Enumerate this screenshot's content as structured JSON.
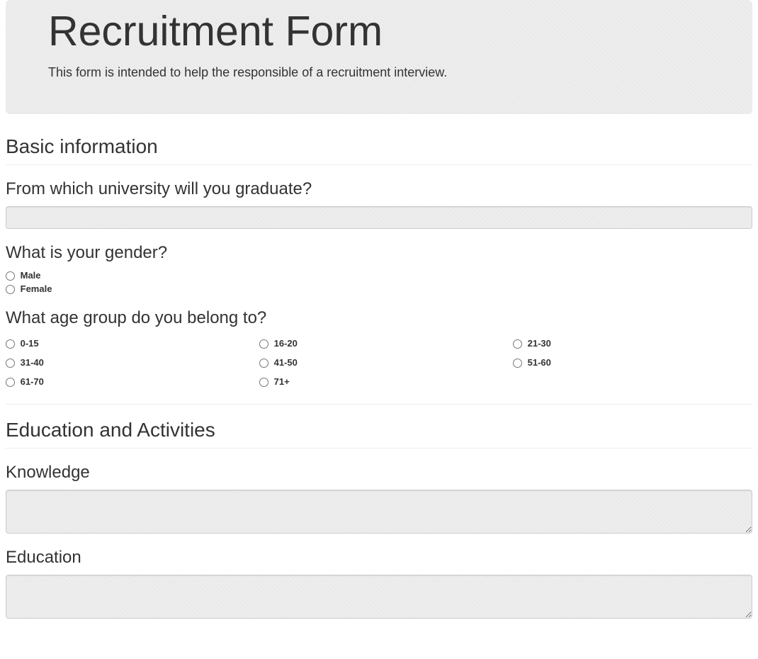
{
  "header": {
    "title": "Recruitment Form",
    "subtitle": "This form is intended to help the responsible of a recruitment interview."
  },
  "section1": {
    "title": "Basic information",
    "q1": {
      "label": "From which university will you graduate?",
      "value": ""
    },
    "q2": {
      "label": "What is your gender?",
      "options": [
        "Male",
        "Female"
      ]
    },
    "q3": {
      "label": "What age group do you belong to?",
      "options": [
        "0-15",
        "16-20",
        "21-30",
        "31-40",
        "41-50",
        "51-60",
        "61-70",
        "71+"
      ]
    }
  },
  "section2": {
    "title": "Education and Activities",
    "q1": {
      "label": "Knowledge",
      "value": ""
    },
    "q2": {
      "label": "Education",
      "value": ""
    }
  }
}
